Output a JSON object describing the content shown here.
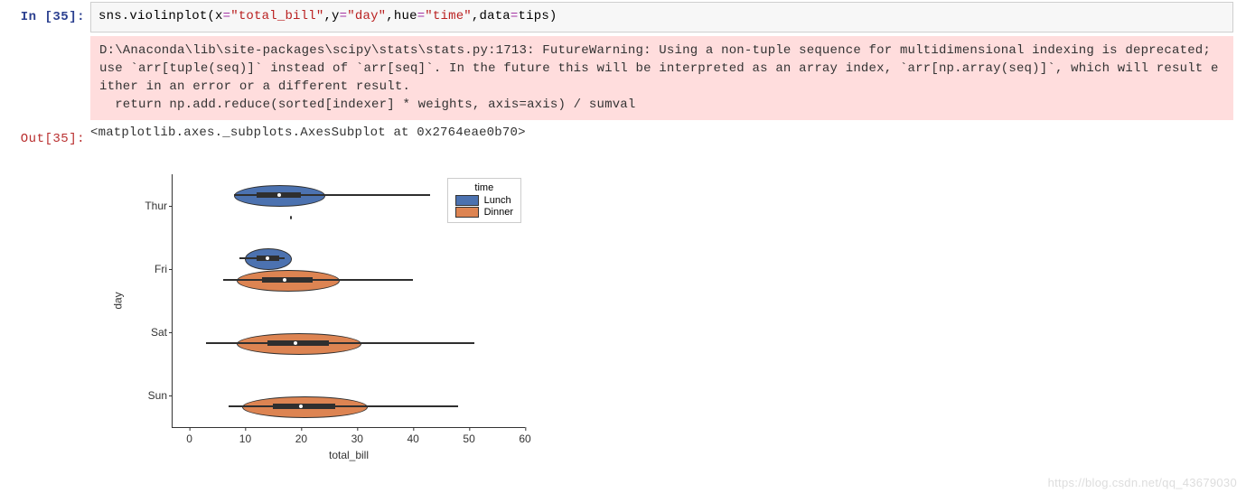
{
  "cell": {
    "in_prompt_prefix": "In  [",
    "in_prompt_num": "35",
    "in_prompt_suffix": "]:",
    "out_prompt_prefix": "Out[",
    "out_prompt_num": "35",
    "out_prompt_suffix": "]:",
    "code_tokens": {
      "t1": "sns.violinplot(x",
      "t2": "=",
      "t3": "\"total_bill\"",
      "t4": ",y",
      "t5": "=",
      "t6": "\"day\"",
      "t7": ",hue",
      "t8": "=",
      "t9": "\"time\"",
      "t10": ",data",
      "t11": "=",
      "t12": "tips)"
    },
    "warning_text": "D:\\Anaconda\\lib\\site-packages\\scipy\\stats\\stats.py:1713: FutureWarning: Using a non-tuple sequence for multidimensional indexing is deprecated; use `arr[tuple(seq)]` instead of `arr[seq]`. In the future this will be interpreted as an array index, `arr[np.array(seq)]`, which will result either in an error or a different result.\n  return np.add.reduce(sorted[indexer] * weights, axis=axis) / sumval",
    "output_text": "<matplotlib.axes._subplots.AxesSubplot at 0x2764eae0b70>"
  },
  "chart_data": {
    "type": "violin",
    "title": "",
    "xlabel": "total_bill",
    "ylabel": "day",
    "y_categories": [
      "Thur",
      "Fri",
      "Sat",
      "Sun"
    ],
    "x_ticks": [
      0,
      10,
      20,
      30,
      40,
      50,
      60
    ],
    "xlim": [
      -3,
      60
    ],
    "hue": "time",
    "legend": {
      "title": "time",
      "entries": [
        "Lunch",
        "Dinner"
      ]
    },
    "colors": {
      "Lunch": "#4c72b0",
      "Dinner": "#dd8452"
    },
    "series": [
      {
        "day": "Thur",
        "time": "Lunch",
        "min": 8,
        "q1": 12,
        "median": 16,
        "q3": 20,
        "max": 43
      },
      {
        "day": "Thur",
        "time": "Dinner",
        "min": 18,
        "q1": 18,
        "median": 18,
        "q3": 18,
        "max": 18
      },
      {
        "day": "Fri",
        "time": "Lunch",
        "min": 9,
        "q1": 12,
        "median": 14,
        "q3": 16,
        "max": 17
      },
      {
        "day": "Fri",
        "time": "Dinner",
        "min": 6,
        "q1": 13,
        "median": 17,
        "q3": 22,
        "max": 40
      },
      {
        "day": "Sat",
        "time": "Dinner",
        "min": 3,
        "q1": 14,
        "median": 19,
        "q3": 25,
        "max": 51
      },
      {
        "day": "Sun",
        "time": "Dinner",
        "min": 7,
        "q1": 15,
        "median": 20,
        "q3": 26,
        "max": 48
      }
    ]
  },
  "watermark": "https://blog.csdn.net/qq_43679030"
}
